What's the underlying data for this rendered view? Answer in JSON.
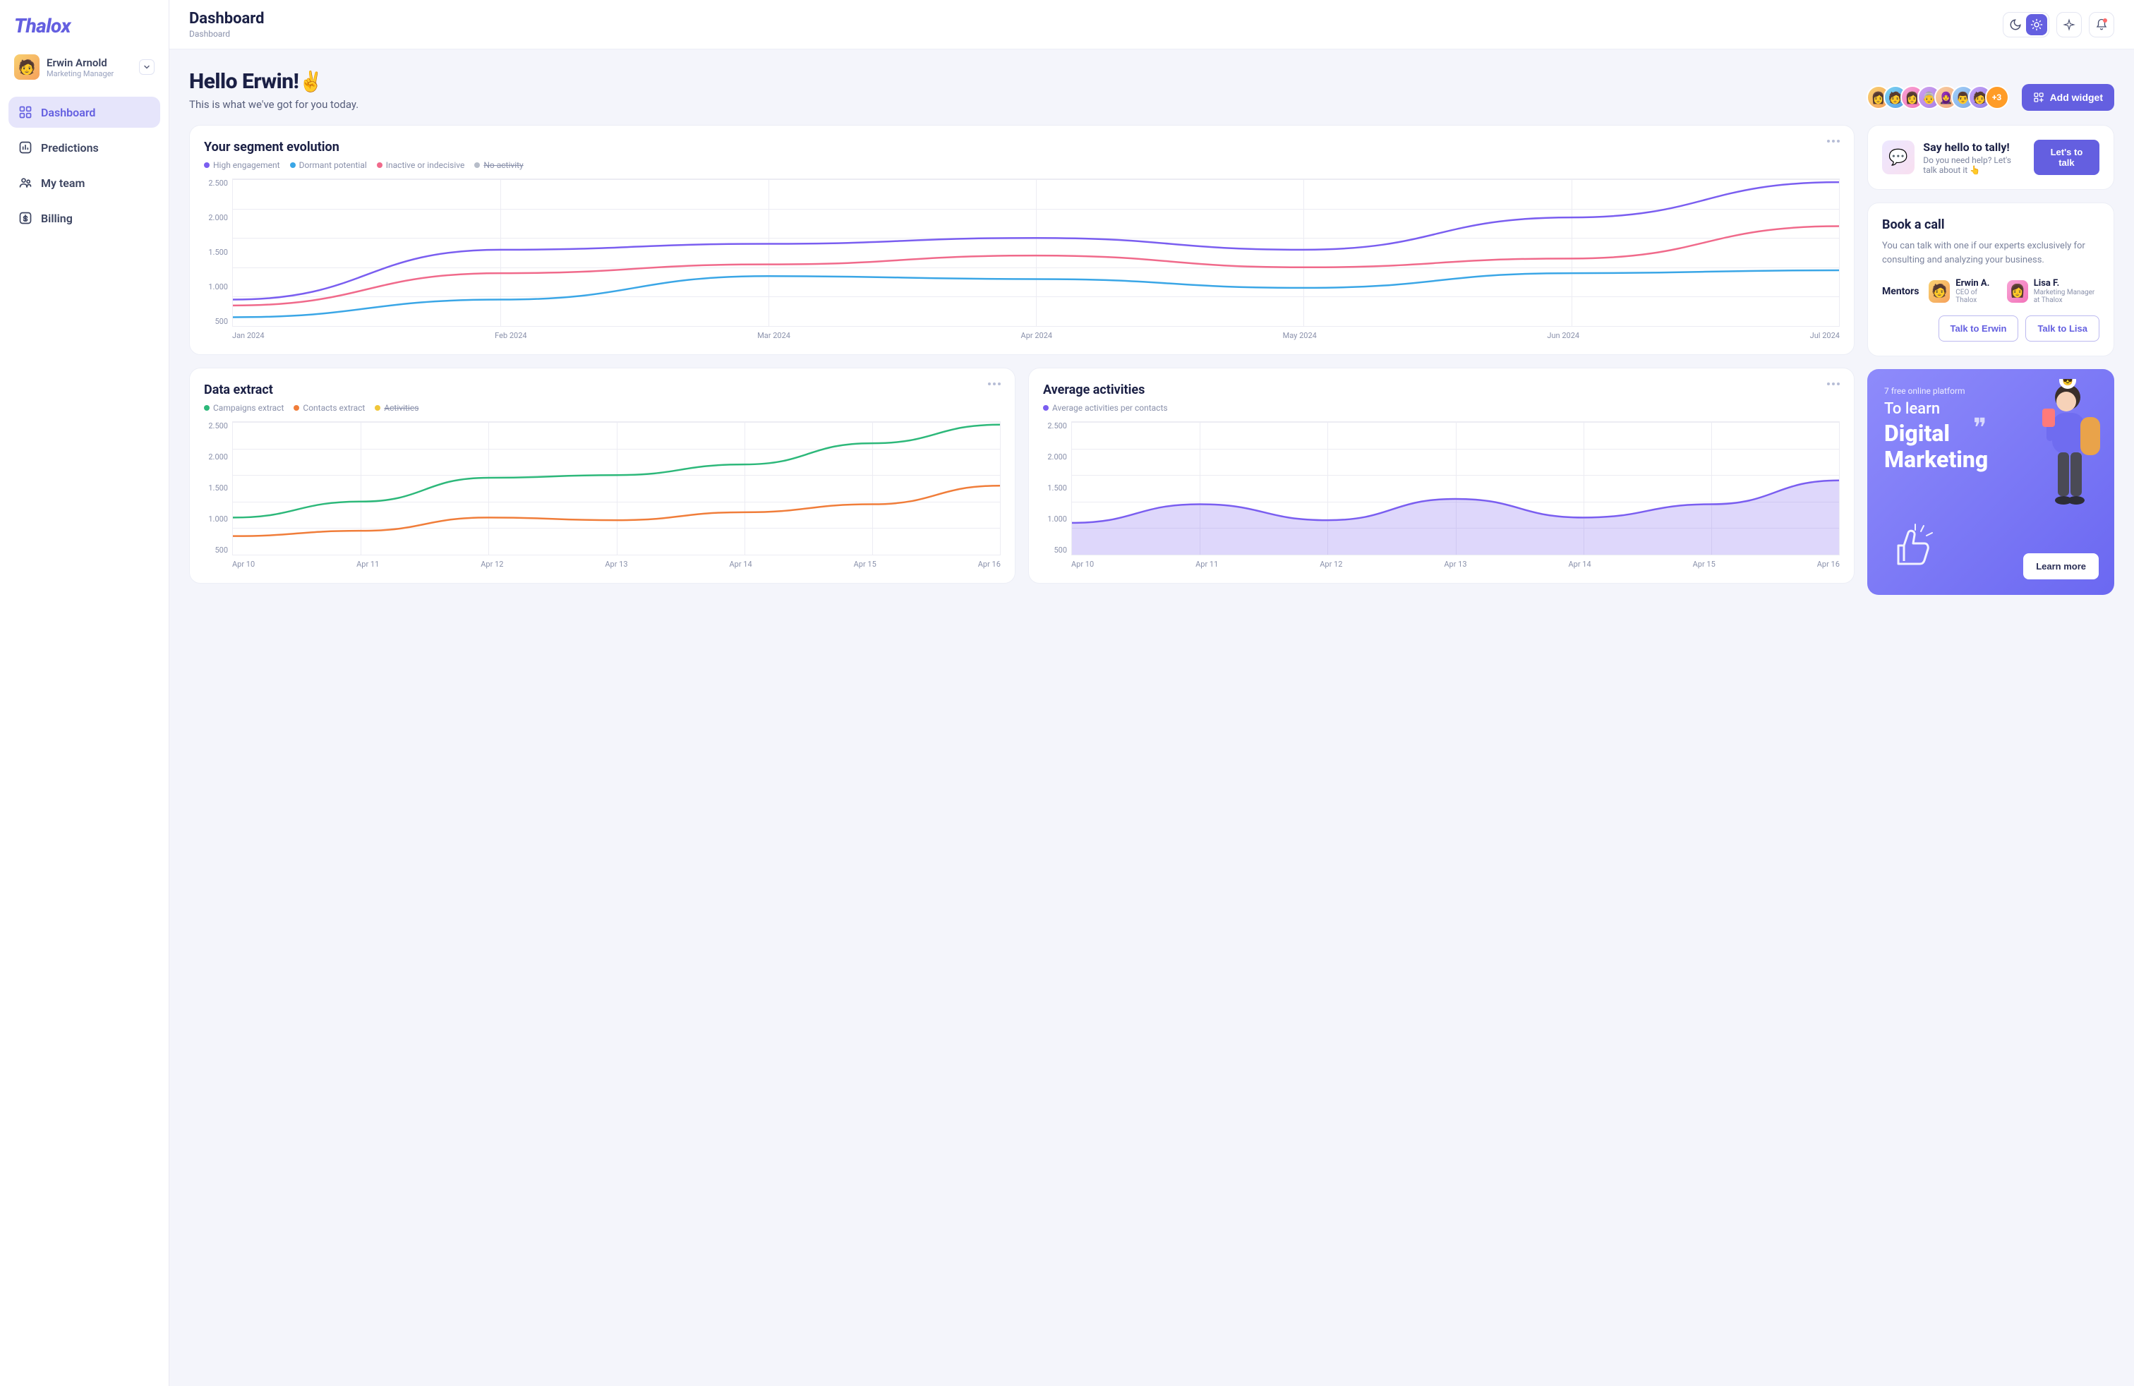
{
  "brand": "Thalox",
  "user": {
    "name": "Erwin Arnold",
    "role": "Marketing Manager"
  },
  "sidebar": {
    "items": [
      {
        "label": "Dashboard",
        "icon": "grid-icon",
        "active": true
      },
      {
        "label": "Predictions",
        "icon": "chart-icon"
      },
      {
        "label": "My team",
        "icon": "team-icon"
      },
      {
        "label": "Billing",
        "icon": "dollar-icon"
      }
    ]
  },
  "topbar": {
    "title": "Dashboard",
    "crumb": "Dashboard"
  },
  "hero": {
    "hello": "Hello Erwin!",
    "emoji": "✌️",
    "sub": "This is what we've got for you today.",
    "avatar_overflow": "+3",
    "add_widget": "Add widget"
  },
  "segment": {
    "title": "Your segment evolution",
    "legend": [
      {
        "label": "High engagement",
        "color": "#7a5ef0"
      },
      {
        "label": "Dormant potential",
        "color": "#3aa6e6"
      },
      {
        "label": "Inactive or indecisive",
        "color": "#f06a8b"
      },
      {
        "label": "No activity",
        "color": "#b7bdc9",
        "strike": true
      }
    ]
  },
  "tally": {
    "title": "Say hello to tally!",
    "sub": "Do you need help? Let's talk about it 👆",
    "btn": "Let's to talk"
  },
  "book": {
    "title": "Book a call",
    "desc": "You can talk with one if our experts exclusively for consulting and analyzing your business.",
    "mentors_label": "Mentors",
    "mentors": [
      {
        "name": "Erwin A.",
        "role": "CEO of Thalox"
      },
      {
        "name": "Lisa F.",
        "role": "Marketing Manager at Thalox"
      }
    ],
    "btn1": "Talk to Erwin",
    "btn2": "Talk to Lisa"
  },
  "extract": {
    "title": "Data extract",
    "legend": [
      {
        "label": "Campaigns extract",
        "color": "#2db87a"
      },
      {
        "label": "Contacts extract",
        "color": "#f07d3a"
      },
      {
        "label": "Activities",
        "color": "#f0c63a",
        "strike": true
      }
    ]
  },
  "activities": {
    "title": "Average activities",
    "legend": [
      {
        "label": "Average activities per contacts",
        "color": "#7a5ef0"
      }
    ]
  },
  "promo": {
    "tag": "7 free online platform",
    "line1": "To learn",
    "big1": "Digital",
    "big2": "Marketing",
    "btn": "Learn more"
  },
  "chart_data": [
    {
      "id": "segment",
      "type": "line",
      "xlabel": "",
      "ylabel": "",
      "ylim": [
        0,
        2500
      ],
      "yticks": [
        500,
        1000,
        1500,
        2000,
        2500
      ],
      "categories": [
        "Jan 2024",
        "Feb 2024",
        "Mar 2024",
        "Apr 2024",
        "May 2024",
        "Jun 2024",
        "Jul 2024"
      ],
      "series": [
        {
          "name": "High engagement",
          "color": "#7a5ef0",
          "values": [
            450,
            1300,
            1400,
            1500,
            1300,
            1850,
            2450
          ]
        },
        {
          "name": "Dormant potential",
          "color": "#3aa6e6",
          "values": [
            150,
            450,
            850,
            800,
            650,
            900,
            950
          ]
        },
        {
          "name": "Inactive or indecisive",
          "color": "#f06a8b",
          "values": [
            350,
            900,
            1050,
            1200,
            1000,
            1150,
            1700
          ]
        }
      ]
    },
    {
      "id": "extract",
      "type": "line",
      "ylim": [
        0,
        2500
      ],
      "yticks": [
        500,
        1000,
        1500,
        2000,
        2500
      ],
      "categories": [
        "Apr 10",
        "Apr 11",
        "Apr 12",
        "Apr 13",
        "Apr 14",
        "Apr 15",
        "Apr 16"
      ],
      "series": [
        {
          "name": "Campaigns extract",
          "color": "#2db87a",
          "values": [
            700,
            1000,
            1450,
            1500,
            1700,
            2100,
            2450
          ]
        },
        {
          "name": "Contacts extract",
          "color": "#f07d3a",
          "values": [
            350,
            450,
            700,
            650,
            800,
            950,
            1300
          ]
        }
      ]
    },
    {
      "id": "activities",
      "type": "area",
      "ylim": [
        0,
        2500
      ],
      "yticks": [
        500,
        1000,
        1500,
        2000,
        2500
      ],
      "categories": [
        "Apr 10",
        "Apr 11",
        "Apr 12",
        "Apr 13",
        "Apr 14",
        "Apr 15",
        "Apr 16"
      ],
      "series": [
        {
          "name": "Average activities per contacts",
          "color": "#7a5ef0",
          "values": [
            600,
            950,
            650,
            1050,
            700,
            950,
            1400
          ]
        }
      ]
    }
  ]
}
